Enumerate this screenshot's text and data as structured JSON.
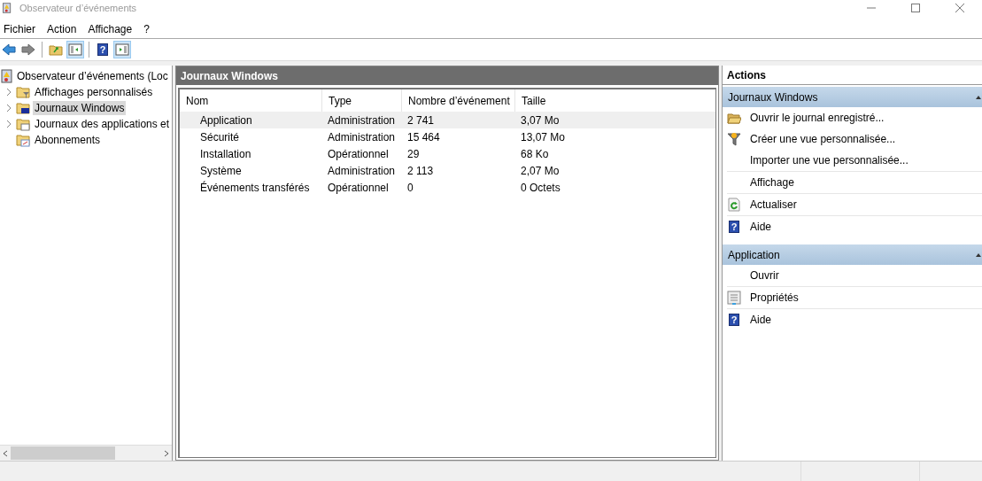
{
  "window": {
    "title": "Observateur d’événements"
  },
  "menu": [
    {
      "label": "Fichier"
    },
    {
      "label": "Action"
    },
    {
      "label": "Affichage"
    },
    {
      "label": "?"
    }
  ],
  "toolbar": [
    {
      "buttons": [
        {
          "kind": "back",
          "pressed": false
        },
        {
          "kind": "forward",
          "pressed": false
        }
      ]
    },
    {
      "buttons": [
        {
          "kind": "folder",
          "pressed": false
        },
        {
          "kind": "pane-left",
          "pressed": true
        }
      ]
    },
    {
      "buttons": [
        {
          "kind": "help",
          "glyph": "?",
          "pressed": false
        },
        {
          "kind": "pane-right",
          "pressed": true
        }
      ]
    }
  ],
  "tree": {
    "label": "Observateur d’événements (Loc",
    "kind": "viewer",
    "children": [
      {
        "label": "Affichages personnalisés",
        "kind": "folder-filter",
        "expandable": true,
        "selected": false
      },
      {
        "label": "Journaux Windows",
        "kind": "folder-monitor",
        "expandable": true,
        "selected": true
      },
      {
        "label": "Journaux des applications et",
        "kind": "folder-window",
        "expandable": true,
        "selected": false
      },
      {
        "label": "Abonnements",
        "kind": "folder-calendar",
        "expandable": false,
        "selected": false
      }
    ]
  },
  "center": {
    "title": "Journaux Windows",
    "columns": [
      "Nom",
      "Type",
      "Nombre d’événement",
      "Taille"
    ],
    "rows": [
      {
        "cells": [
          "Application",
          "Administration",
          "2 741",
          "3,07 Mo"
        ],
        "selected": true
      },
      {
        "cells": [
          "Sécurité",
          "Administration",
          "15 464",
          "13,07 Mo"
        ],
        "selected": false
      },
      {
        "cells": [
          "Installation",
          "Opérationnel",
          "29",
          "68 Ko"
        ],
        "selected": false
      },
      {
        "cells": [
          "Système",
          "Administration",
          "2 113",
          "2,07 Mo"
        ],
        "selected": false
      },
      {
        "cells": [
          "Événements transférés",
          "Opérationnel",
          "0",
          "0 Octets"
        ],
        "selected": false
      }
    ]
  },
  "actions": {
    "title": "Actions",
    "sections": [
      {
        "title": "Journaux Windows",
        "items": [
          {
            "label": "Ouvrir le journal enregistré...",
            "kind": "open-folder",
            "divider_above": false
          },
          {
            "label": "Créer une vue personnalisée...",
            "kind": "filter",
            "divider_above": false
          },
          {
            "label": "Importer une vue personnalisée...",
            "kind": "plain",
            "divider_above": false
          },
          {
            "label": "Affichage",
            "kind": "plain",
            "divider_above": true
          },
          {
            "label": "Actualiser",
            "kind": "refresh",
            "divider_above": true
          },
          {
            "label": "Aide",
            "kind": "help",
            "glyph": "?",
            "divider_above": true
          }
        ]
      },
      {
        "title": "Application",
        "items": [
          {
            "label": "Ouvrir",
            "kind": "plain",
            "divider_above": false
          },
          {
            "label": "Propriétés",
            "kind": "properties",
            "divider_above": true
          },
          {
            "label": "Aide",
            "kind": "help",
            "glyph": "?",
            "divider_above": true
          }
        ]
      }
    ]
  }
}
